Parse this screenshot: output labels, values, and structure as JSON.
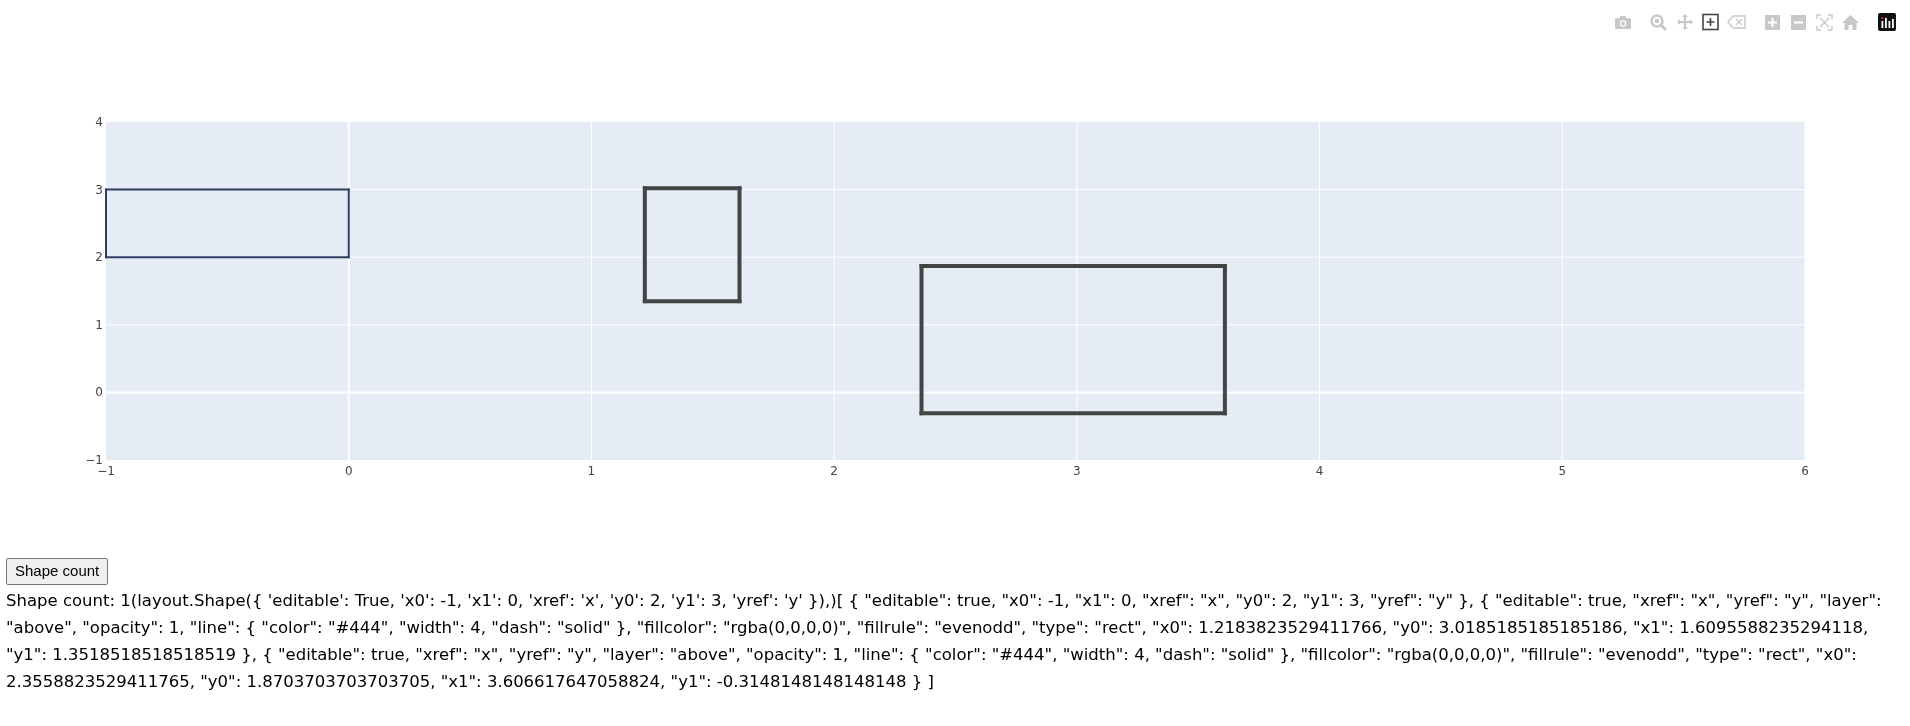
{
  "modebar": [
    {
      "kind": "camera",
      "selected": false
    },
    {
      "kind": "zoom",
      "selected": false
    },
    {
      "kind": "pan",
      "selected": false
    },
    {
      "kind": "drawrect",
      "selected": true
    },
    {
      "kind": "erase",
      "selected": false
    },
    {
      "kind": "zoomin",
      "selected": false
    },
    {
      "kind": "zoomout",
      "selected": false
    },
    {
      "kind": "autoscale",
      "selected": false
    },
    {
      "kind": "home",
      "selected": false
    },
    {
      "kind": "logo"
    }
  ],
  "plot": {
    "chart_data": {
      "type": "line",
      "grid": true,
      "xlim": [
        -1,
        6
      ],
      "ylim": [
        -1,
        4
      ],
      "xticks": [
        {
          "value": -1,
          "label": "−1"
        },
        0,
        1,
        2,
        3,
        4,
        5,
        6
      ],
      "yticks": [
        {
          "value": -1,
          "label": "−1"
        },
        0,
        1,
        2,
        3,
        4
      ],
      "x": [
        -1,
        0,
        1.22,
        1.61,
        2.36,
        3.61
      ],
      "series": [
        {
          "color": "#2a3f5f",
          "values": [
            3,
            3,
            null,
            null,
            null,
            null
          ]
        },
        {
          "color": "#2a3f5f",
          "values": [
            2,
            2,
            null,
            null,
            null,
            null
          ]
        },
        {
          "color": "#444444",
          "values": [
            null,
            null,
            3.02,
            3.02,
            null,
            null
          ]
        },
        {
          "color": "#444444",
          "values": [
            null,
            null,
            1.35,
            1.35,
            null,
            null
          ]
        },
        {
          "color": "#444444",
          "values": [
            null,
            null,
            null,
            null,
            1.87,
            1.87
          ]
        },
        {
          "color": "#444444",
          "values": [
            null,
            null,
            null,
            null,
            -0.31,
            -0.31
          ]
        }
      ]
    }
  },
  "button": {
    "label": "Shape count"
  },
  "output": "Shape count: 1(layout.Shape({ 'editable': True, 'x0': -1, 'x1': 0, 'xref': 'x', 'y0': 2, 'y1': 3, 'yref': 'y' }),)[ { \"editable\": true, \"x0\": -1, \"x1\": 0, \"xref\": \"x\", \"y0\": 2, \"y1\": 3, \"yref\": \"y\" }, { \"editable\": true, \"xref\": \"x\", \"yref\": \"y\", \"layer\": \"above\", \"opacity\": 1, \"line\": { \"color\": \"#444\", \"width\": 4, \"dash\": \"solid\" }, \"fillcolor\": \"rgba(0,0,0,0)\", \"fillrule\": \"evenodd\", \"type\": \"rect\", \"x0\": 1.2183823529411766, \"y0\": 3.0185185185185186, \"x1\": 1.6095588235294118, \"y1\": 1.3518518518518519 }, { \"editable\": true, \"xref\": \"x\", \"yref\": \"y\", \"layer\": \"above\", \"opacity\": 1, \"line\": { \"color\": \"#444\", \"width\": 4, \"dash\": \"solid\" }, \"fillcolor\": \"rgba(0,0,0,0)\", \"fillrule\": \"evenodd\", \"type\": \"rect\", \"x0\": 2.3558823529411765, \"y0\": 1.8703703703703705, \"x1\": 3.606617647058824, \"y1\": -0.3148148148148148 } ]"
}
